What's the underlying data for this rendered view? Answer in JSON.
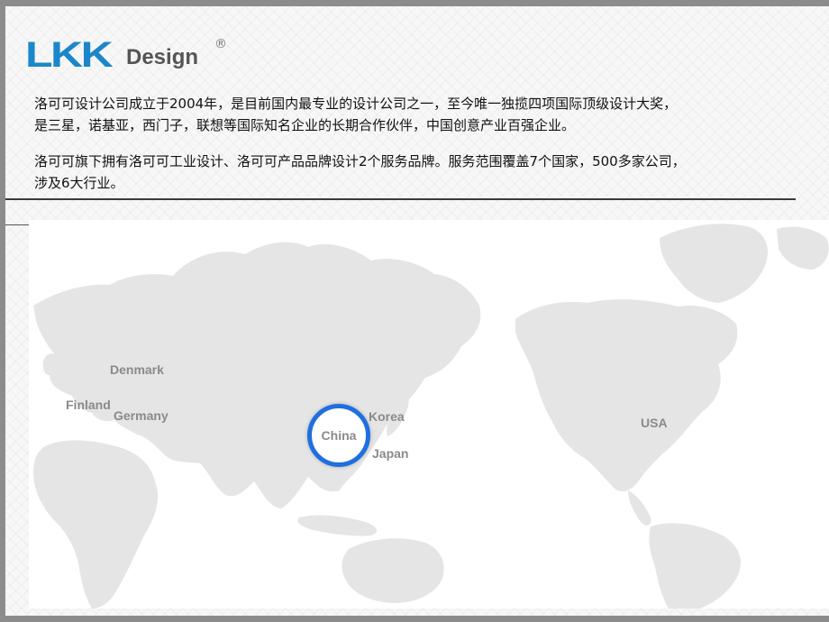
{
  "logo": {
    "brand": "LKK",
    "wordmark": "Design",
    "registered_mark": "®",
    "brand_color": "#1b87c9"
  },
  "intro": {
    "paragraph1_line1": "洛可可设计公司成立于2004年，是目前国内最专业的设计公司之一，至今唯一独揽四项国际顶级设计大奖，",
    "paragraph1_line2": "是三星，诺基亚，西门子，联想等国际知名企业的长期合作伙伴，中国创意产业百强企业。",
    "paragraph2_line1": "洛可可旗下拥有洛可可工业设计、洛可可产品品牌设计2个服务品牌。服务范围覆盖7个国家，500多家公司，",
    "paragraph2_line2": "涉及6大行业。"
  },
  "map": {
    "countries": [
      "Denmark",
      "Finland",
      "Germany",
      "China",
      "Korea",
      "Japan",
      "USA"
    ],
    "highlight": "China",
    "highlight_color": "#1f6fe0"
  }
}
